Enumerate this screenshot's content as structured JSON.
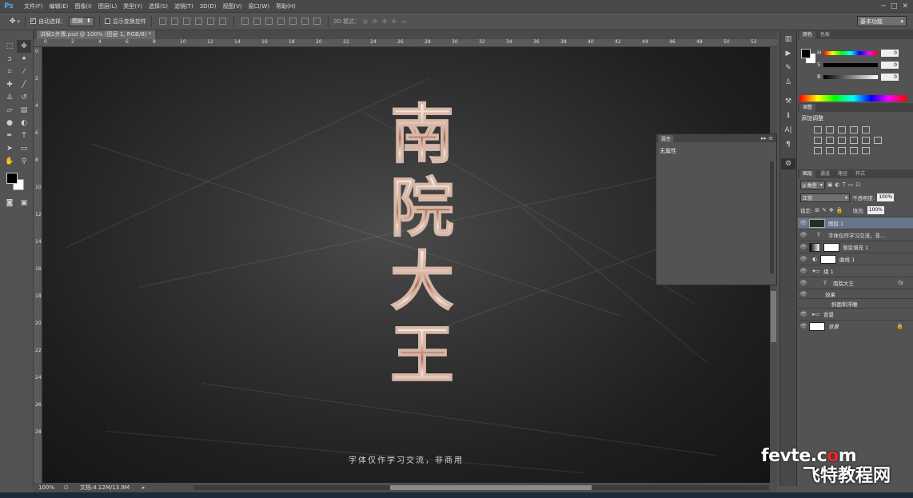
{
  "app": {
    "logo": "Ps",
    "menu": [
      "文件(F)",
      "编辑(E)",
      "图像(I)",
      "图层(L)",
      "类型(Y)",
      "选择(S)",
      "滤镜(T)",
      "3D(D)",
      "视图(V)",
      "窗口(W)",
      "帮助(H)"
    ],
    "window_controls": [
      "─",
      "□",
      "✕"
    ]
  },
  "options": {
    "auto_select_label": "自动选择：",
    "auto_select_value": "图层",
    "show_transform_label": "显示变换控件",
    "mode_3d_label": "3D 模式：",
    "workspace": "基本功能"
  },
  "document": {
    "tab_title": "讲解2步骤.psd @ 100% (图层 1, RGB/8) *",
    "ruler_numbers": [
      "0",
      "2",
      "4",
      "6",
      "8",
      "10",
      "12",
      "14",
      "16",
      "18",
      "20",
      "22",
      "24",
      "26",
      "28",
      "30",
      "32",
      "34",
      "36",
      "38",
      "40",
      "42",
      "44",
      "46",
      "48",
      "50",
      "52"
    ],
    "ruler_left_numbers": [
      "0",
      "2",
      "4",
      "6",
      "8",
      "10",
      "12",
      "14",
      "16",
      "18",
      "20",
      "22",
      "24",
      "26",
      "28"
    ],
    "title_glyphs": [
      "南",
      "院",
      "大",
      "王"
    ],
    "caption": "字体仅作学习交流，非商用"
  },
  "status": {
    "zoom": "100%",
    "doc_size": "文档:4.12M/13.9M"
  },
  "properties_panel": {
    "tab": "属性",
    "body": "无属性"
  },
  "color_panel": {
    "tabs": [
      "颜色",
      "色板"
    ],
    "sliders": [
      {
        "label": "H",
        "value": "0"
      },
      {
        "label": "S",
        "value": "0"
      },
      {
        "label": "B",
        "value": "0"
      }
    ]
  },
  "adjust_panel": {
    "tab": "调整",
    "title": "添加调整"
  },
  "layers_panel": {
    "tabs": [
      "图层",
      "通道",
      "路径",
      "样式"
    ],
    "filter_kind": "ρ 类型",
    "blend_mode": "正常",
    "opacity_label": "不透明度:",
    "opacity_value": "100%",
    "lock_label": "锁定:",
    "fill_label": "填充:",
    "fill_value": "100%",
    "layers": [
      {
        "name": "图层 1",
        "selected": true
      },
      {
        "name": "字体仅作学习交流，非…"
      },
      {
        "name": "渐变填充 1"
      },
      {
        "name": "曲线 1"
      },
      {
        "name": "组 1"
      },
      {
        "name": "南院大王",
        "fx": "fx"
      },
      {
        "name": "效果"
      },
      {
        "name": "斜面和浮雕"
      },
      {
        "name": "背景"
      },
      {
        "name": "背景"
      }
    ]
  },
  "watermark": {
    "line1_prefix": "fevte.c",
    "line1_o": "o",
    "line1_suffix": "m",
    "line2": "飞特教程网"
  }
}
